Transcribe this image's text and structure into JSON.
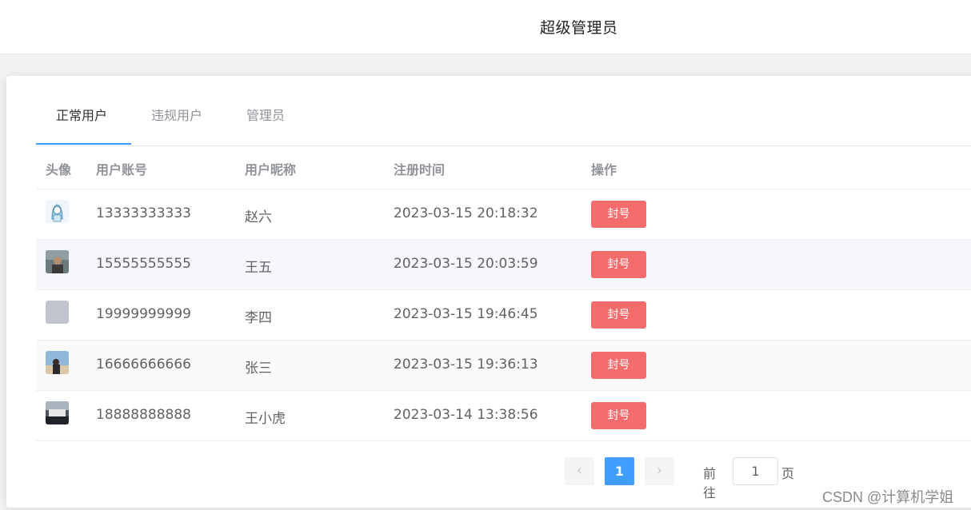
{
  "header": {
    "user_label": "超级管理员"
  },
  "tabs": [
    {
      "label": "正常用户",
      "active": true
    },
    {
      "label": "违规用户",
      "active": false
    },
    {
      "label": "管理员",
      "active": false
    }
  ],
  "table": {
    "columns": [
      "头像",
      "用户账号",
      "用户昵称",
      "注册时间",
      "操作"
    ],
    "rows": [
      {
        "account": "13333333333",
        "nickname": "赵六",
        "registered": "2023-03-15 20:18:32",
        "action": "封号",
        "avatar": "anime-girl-avatar"
      },
      {
        "account": "15555555555",
        "nickname": "王五",
        "registered": "2023-03-15 20:03:59",
        "action": "封号",
        "avatar": "photo-avatar"
      },
      {
        "account": "19999999999",
        "nickname": "李四",
        "registered": "2023-03-15 19:46:45",
        "action": "封号",
        "avatar": "placeholder-avatar"
      },
      {
        "account": "16666666666",
        "nickname": "张三",
        "registered": "2023-03-15 19:36:13",
        "action": "封号",
        "avatar": "photo-avatar"
      },
      {
        "account": "18888888888",
        "nickname": "王小虎",
        "registered": "2023-03-14 13:38:56",
        "action": "封号",
        "avatar": "photo-avatar"
      }
    ]
  },
  "pagination": {
    "prev": "‹",
    "current_page": "1",
    "next": "›",
    "goto_prefix": "前往",
    "goto_value": "1",
    "goto_suffix": "页"
  },
  "watermark": "CSDN @计算机学姐",
  "colors": {
    "primary": "#409eff",
    "danger": "#f56c6c"
  }
}
